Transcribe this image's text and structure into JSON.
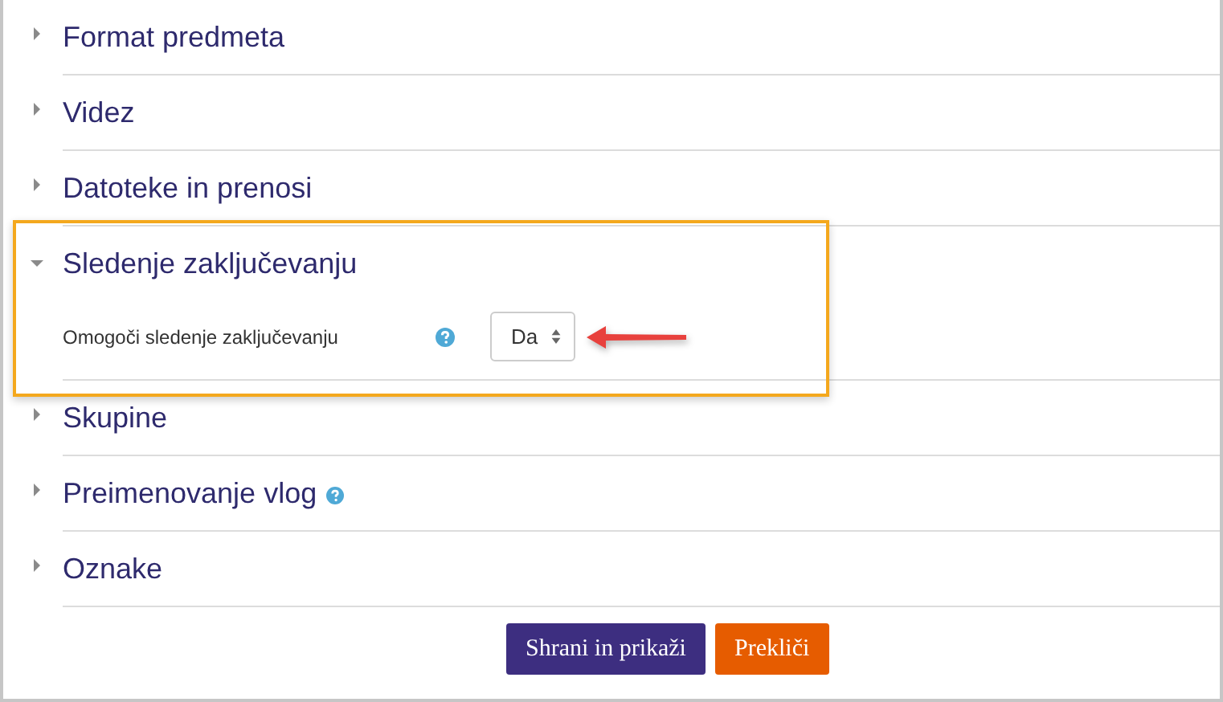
{
  "sections": [
    {
      "title": "Format predmeta",
      "expanded": false,
      "help": false
    },
    {
      "title": "Videz",
      "expanded": false,
      "help": false
    },
    {
      "title": "Datoteke in prenosi",
      "expanded": false,
      "help": false
    },
    {
      "title": "Sledenje zaključevanju",
      "expanded": true,
      "help": false,
      "highlighted": true,
      "fields": [
        {
          "label": "Omogoči sledenje zaključevanju",
          "help": true,
          "value": "Da",
          "arrow": true
        }
      ]
    },
    {
      "title": "Skupine",
      "expanded": false,
      "help": false
    },
    {
      "title": "Preimenovanje vlog",
      "expanded": false,
      "help": true
    },
    {
      "title": "Oznake",
      "expanded": false,
      "help": false
    }
  ],
  "buttons": [
    {
      "label": "Shrani in prikaži",
      "kind": "primary"
    },
    {
      "label": "Prekliči",
      "kind": "cancel"
    }
  ]
}
